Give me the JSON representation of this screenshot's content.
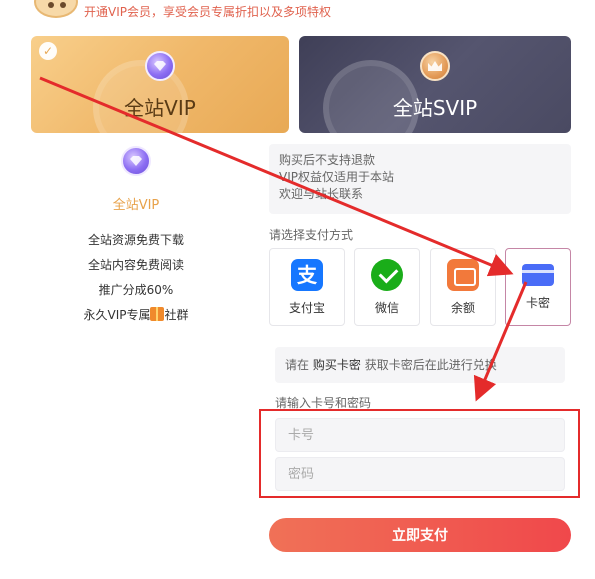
{
  "header": {
    "promo_text": "开通VIP会员，享受会员专属折扣以及多项特权"
  },
  "plans": {
    "vip": {
      "label": "全站VIP",
      "selected": true
    },
    "svip": {
      "label": "全站SVIP",
      "selected": false
    }
  },
  "vip_detail": {
    "title": "全站VIP",
    "benefits": [
      "全站资源免费下载",
      "全站内容免费阅读",
      "推广分成60%",
      "永久VIP专属",
      "社群"
    ]
  },
  "notice": {
    "lines": [
      "购买后不支持退款",
      "VIP权益仅适用于本站",
      "欢迎与站长联系"
    ]
  },
  "payment": {
    "section_label": "请选择支付方式",
    "methods": [
      {
        "label": "支付宝",
        "icon": "alipay-icon"
      },
      {
        "label": "微信",
        "icon": "wechat-icon"
      },
      {
        "label": "余额",
        "icon": "wallet-icon"
      },
      {
        "label": "卡密",
        "icon": "card-icon",
        "selected": true
      }
    ]
  },
  "card_redeem": {
    "hint_prefix": "请在",
    "hint_link": "购买卡密",
    "hint_suffix": "获取卡密后在此进行兑换",
    "input_label": "请输入卡号和密码",
    "card_placeholder": "卡号",
    "password_placeholder": "密码"
  },
  "submit": {
    "label": "立即支付"
  },
  "colors": {
    "accent": "#f0484b",
    "vip_gold": "#e8a24a",
    "annotation_red": "#e42b2b"
  }
}
